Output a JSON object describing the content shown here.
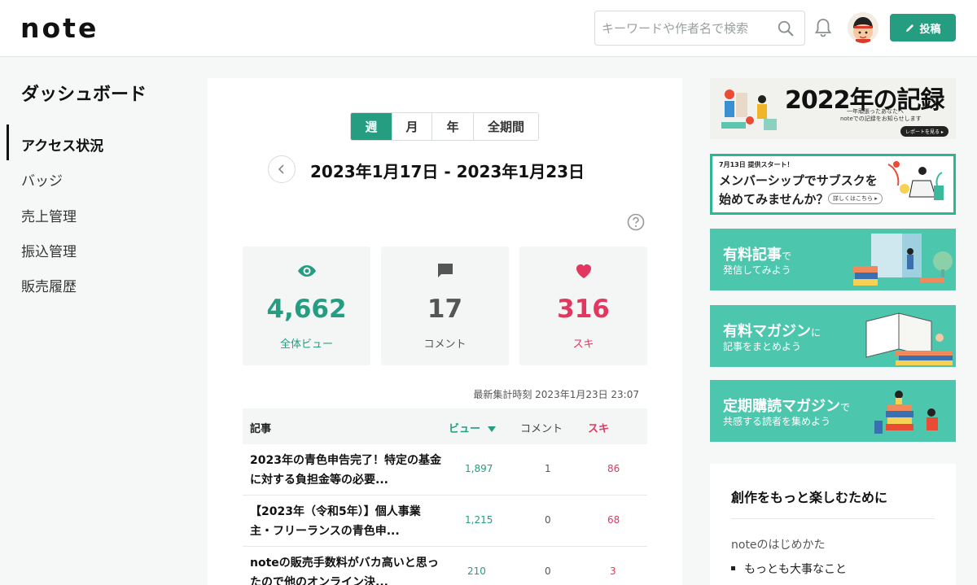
{
  "header": {
    "logo": "note",
    "search_placeholder": "キーワードや作者名で検索",
    "post_label": "投稿"
  },
  "sidebar": {
    "title": "ダッシュボード",
    "items": [
      {
        "label": "アクセス状況",
        "active": true
      },
      {
        "label": "バッジ"
      },
      {
        "label": "売上管理"
      },
      {
        "label": "振込管理"
      },
      {
        "label": "販売履歴"
      }
    ]
  },
  "main": {
    "period_tabs": [
      "週",
      "月",
      "年",
      "全期間"
    ],
    "active_period": "週",
    "date_range": "2023年1月17日  -  2023年1月23日",
    "stats": [
      {
        "value": "4,662",
        "label": "全体ビュー",
        "icon": "eye-icon",
        "color": "#249d81"
      },
      {
        "value": "17",
        "label": "コメント",
        "icon": "comment-icon",
        "color": "#555555"
      },
      {
        "value": "316",
        "label": "スキ",
        "icon": "heart-icon",
        "color": "#e2375e"
      }
    ],
    "updated": "最新集計時刻 2023年1月23日 23:07",
    "table": {
      "headers": {
        "article": "記事",
        "views": "ビュー",
        "comments": "コメント",
        "likes": "スキ"
      },
      "rows": [
        {
          "title": "2023年の青色申告完了！特定の基金に対する負担金等の必要...",
          "views": "1,897",
          "comments": "1",
          "likes": "86"
        },
        {
          "title": "【2023年（令和5年）】個人事業主・フリーランスの青色申...",
          "views": "1,215",
          "comments": "0",
          "likes": "68"
        },
        {
          "title": "noteの販売手数料がバカ高いと思ったので他のオンライン決...",
          "views": "210",
          "comments": "0",
          "likes": "3"
        }
      ]
    }
  },
  "right": {
    "record_banner": {
      "title": "2022年の記録",
      "sub1": "一年頑張ったあなたへ",
      "sub2": "noteでの記録をお知らせします",
      "button": "レポートを見る ▸"
    },
    "membership_banner": {
      "tag": "7月13日 提供スタート！",
      "line1": "メンバーシップでサブスクを",
      "line2": "始めてみませんか？",
      "more": "詳しくはこちら ▸"
    },
    "green_banners": [
      {
        "title": "有料記事",
        "suffix": "で",
        "sub": "発信してみよう"
      },
      {
        "title": "有料マガジン",
        "suffix": "に",
        "sub": "記事をまとめよう"
      },
      {
        "title": "定期購読マガジン",
        "suffix": "で",
        "sub": "共感する読者を集めよう"
      }
    ],
    "enjoy": {
      "title": "創作をもっと楽しむために",
      "section": "noteのはじめかた",
      "item": "もっとも大事なこと"
    }
  },
  "colors": {
    "accent": "#249d81",
    "like": "#e2375e",
    "banner_green": "#4cc7ad"
  }
}
